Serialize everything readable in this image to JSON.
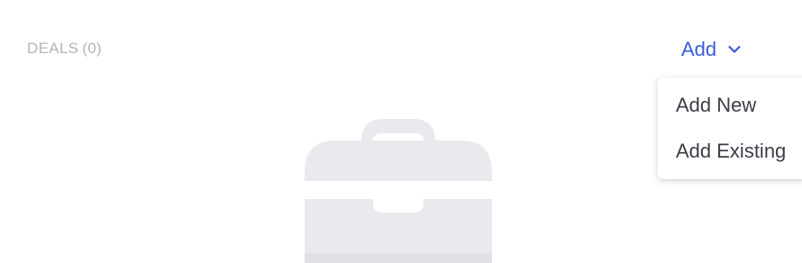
{
  "section": {
    "title": "DEALS",
    "count": "(0)"
  },
  "add_menu": {
    "toggle_label": "Add",
    "toggle_icon": "chevron-down-icon",
    "items": [
      {
        "label": "Add New"
      },
      {
        "label": "Add Existing"
      }
    ]
  },
  "empty_state": {
    "icon": "briefcase-icon"
  },
  "colors": {
    "accent": "#3b5bdb",
    "muted_text": "#b3b5ba",
    "menu_text": "#3a3e47",
    "illustration": "#e9eaee"
  }
}
